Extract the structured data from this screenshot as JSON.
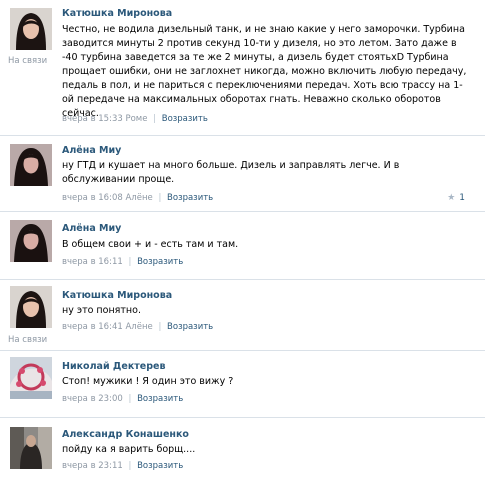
{
  "status_online": "На связи",
  "reply_label": "Возразить",
  "posts": [
    {
      "author": "Катюшка Миронова",
      "text": "Честно, не водила дизельный танк, и не знаю какие у него заморочки. Турбина заводится минуты 2 против секунд 10-ти у дизеля, но это летом. Зато даже в -40 турбина заведется за те же 2 минуты, а дизель будет стоятьхD Турбина прощает ошибки, они не заглохнет никогда, можно включить любую передачу, педаль в пол, и не париться с переключениями передач. Хоть всю трассу на 1-ой передаче на максимальных оборотах гнать. Неважно сколько оборотов сейчас.",
      "time": "вчера в 15:33",
      "addressee": "Роме"
    },
    {
      "author": "Алёна Миу",
      "text": "ну ГТД и кушает на много больше. Дизель и заправлять легче. И в обслуживании проще.",
      "time": "вчера в 16:08",
      "addressee": "Алёне",
      "likes": "1"
    },
    {
      "author": "Алёна Миу",
      "text": "В общем свои + и - есть там и там.",
      "time": "вчера в 16:11"
    },
    {
      "author": "Катюшка Миронова",
      "text": "ну это понятно.",
      "time": "вчера в 16:41",
      "addressee": "Алёне"
    },
    {
      "author": "Николай Дектерев",
      "text": "Стоп! мужики ! Я один это вижу ?",
      "time": "вчера в 23:00"
    },
    {
      "author": "Александр Конашенко",
      "text": "пойду ка я варить борщ....",
      "time": "вчера в 23:11"
    }
  ]
}
